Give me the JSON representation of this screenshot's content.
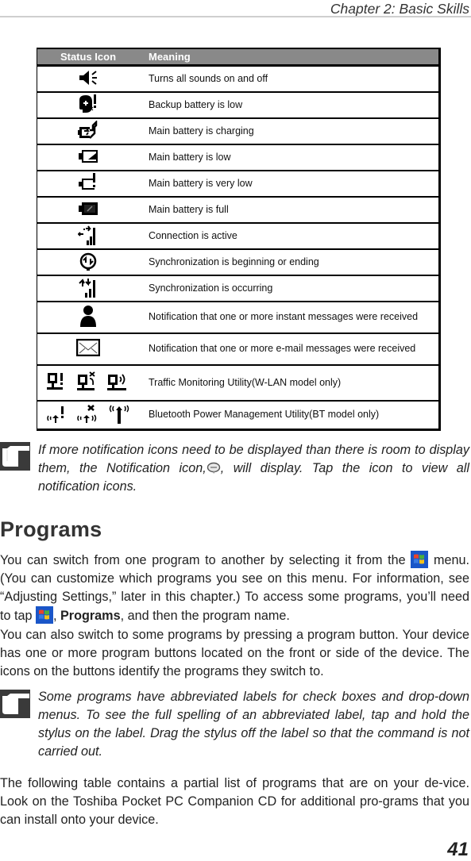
{
  "header": {
    "running_head": "Chapter 2: Basic Skills"
  },
  "status_table": {
    "columns": [
      "Status Icon",
      "Meaning"
    ],
    "rows": [
      {
        "icons": [
          "speaker-icon"
        ],
        "meaning": "Turns all sounds on and off"
      },
      {
        "icons": [
          "backup-battery-low-icon"
        ],
        "meaning": "Backup battery is low"
      },
      {
        "icons": [
          "battery-charging-icon"
        ],
        "meaning": "Main battery is charging"
      },
      {
        "icons": [
          "battery-low-icon"
        ],
        "meaning": "Main battery is low"
      },
      {
        "icons": [
          "battery-very-low-icon"
        ],
        "meaning": "Main battery is very low"
      },
      {
        "icons": [
          "battery-full-icon"
        ],
        "meaning": "Main battery is full"
      },
      {
        "icons": [
          "connection-active-icon"
        ],
        "meaning": "Connection is active"
      },
      {
        "icons": [
          "sync-begin-end-icon"
        ],
        "meaning": "Synchronization is beginning or ending"
      },
      {
        "icons": [
          "sync-occurring-icon"
        ],
        "meaning": "Synchronization is occurring"
      },
      {
        "icons": [
          "instant-message-icon"
        ],
        "meaning": "Notification that one or more instant messages were received"
      },
      {
        "icons": [
          "email-icon"
        ],
        "meaning": "Notification that one or more e-mail messages were received"
      },
      {
        "icons": [
          "wlan-alert-icon",
          "wlan-disconnected-icon",
          "wlan-active-icon"
        ],
        "meaning": "Traffic Monitoring Utility(W-LAN model only)"
      },
      {
        "icons": [
          "bt-alert-icon",
          "bt-off-icon",
          "bt-on-icon"
        ],
        "meaning": "Bluetooth Power Management Utility(BT model only)"
      }
    ]
  },
  "note1": {
    "icon": "pointing-hand-icon",
    "text_before": "If more notification icons need to be displayed than there is room to display them, the Notification icon,",
    "inline_icon": "notification-bubble-icon",
    "text_after": ", will display. Tap the icon to view all notification icons."
  },
  "section": {
    "title": "Programs"
  },
  "paragraph1": {
    "part1": "You can switch from one program to another by selecting it from the ",
    "start_icon": "windows-start-icon",
    "part2": " menu. (You can customize which programs you see on this menu. For information, see “Adjusting Settings,” later in this chapter.) To access some programs, you’ll need to tap ",
    "part3": ", ",
    "bold": "Programs",
    "part4": ", and then the program name."
  },
  "paragraph2": "You can also switch to some programs by pressing a program button. Your device has one or more program buttons located on the front or side of the device. The icons on the buttons identify the programs they switch to.",
  "note2": {
    "icon": "pointing-hand-icon",
    "text": "Some programs have abbreviated labels for check boxes and drop-down menus. To see the full spelling of an  abbreviated label, tap and hold the stylus on the label. Drag the stylus off the label so that the command is not carried out."
  },
  "paragraph3": "The following table contains a partial list of programs that are on your de-vice. Look on the Toshiba Pocket PC Companion CD for additional pro-grams that you can install onto your device.",
  "footer": {
    "page_number": "41"
  }
}
